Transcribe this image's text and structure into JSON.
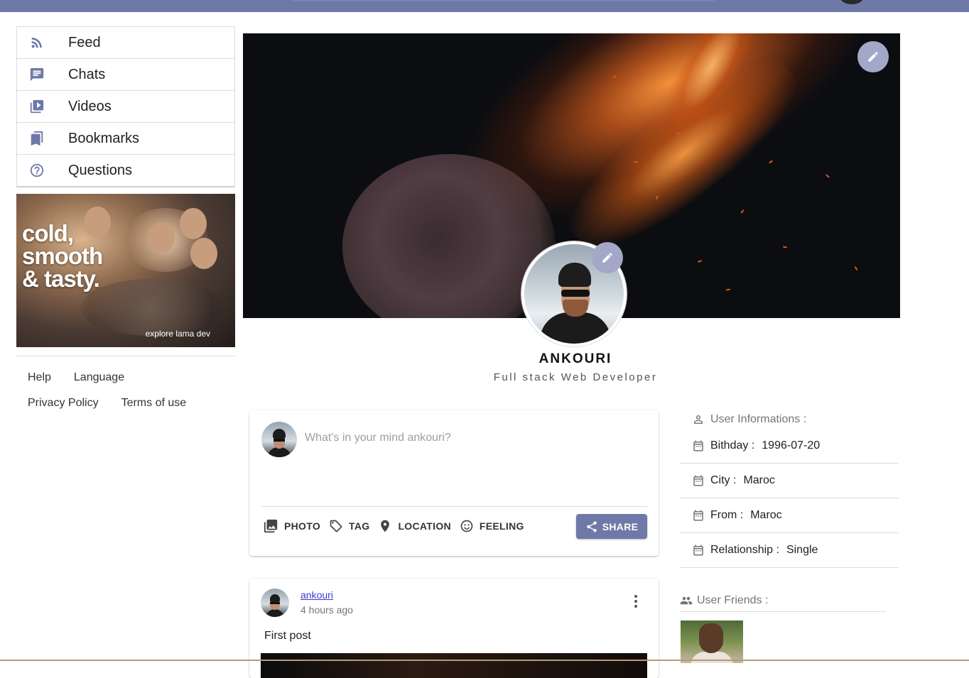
{
  "sidebar": {
    "items": [
      {
        "label": "Feed",
        "icon": "rss-feed-icon"
      },
      {
        "label": "Chats",
        "icon": "chat-icon"
      },
      {
        "label": "Videos",
        "icon": "video-library-icon"
      },
      {
        "label": "Bookmarks",
        "icon": "bookmarks-icon"
      },
      {
        "label": "Questions",
        "icon": "help-outline-icon"
      }
    ],
    "ad": {
      "slogan_line1": "cold,",
      "slogan_line2": "smooth",
      "slogan_line3": "& tasty.",
      "cta": "explore lama dev"
    },
    "footer_links": [
      "Help",
      "Language",
      "Privacy Policy",
      "Terms of use"
    ]
  },
  "profile": {
    "name": "ANKOURI",
    "bio": "Full stack Web Developer"
  },
  "share": {
    "placeholder": "What's in your mind ankouri?",
    "actions": [
      "PHOTO",
      "TAG",
      "LOCATION",
      "FEELING"
    ],
    "share_label": "SHARE"
  },
  "post": {
    "author": "ankouri",
    "time": "4 hours ago",
    "text": "First post"
  },
  "user_info": {
    "title": "User Informations :",
    "rows": [
      {
        "key": "Bithday :",
        "value": "1996-07-20"
      },
      {
        "key": "City :",
        "value": "Maroc"
      },
      {
        "key": "From :",
        "value": "Maroc"
      },
      {
        "key": "Relationship :",
        "value": "Single"
      }
    ]
  },
  "friends": {
    "title": "User Friends :"
  },
  "colors": {
    "accent": "#6f79a8",
    "fab": "#a3a8c8",
    "icon": "#6f79a8"
  }
}
